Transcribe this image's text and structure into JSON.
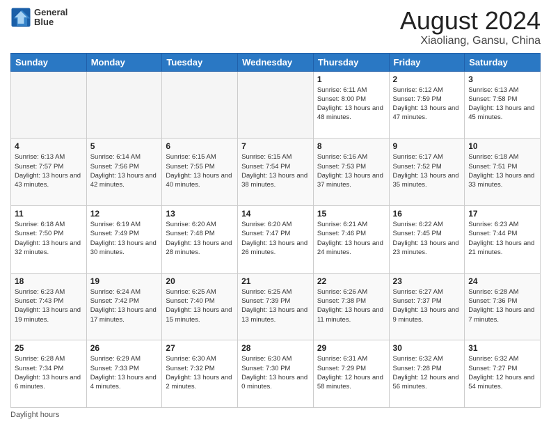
{
  "header": {
    "logo_line1": "General",
    "logo_line2": "Blue",
    "title": "August 2024",
    "subtitle": "Xiaoliang, Gansu, China"
  },
  "footer": {
    "label": "Daylight hours"
  },
  "days_of_week": [
    "Sunday",
    "Monday",
    "Tuesday",
    "Wednesday",
    "Thursday",
    "Friday",
    "Saturday"
  ],
  "weeks": [
    [
      {
        "day": "",
        "info": ""
      },
      {
        "day": "",
        "info": ""
      },
      {
        "day": "",
        "info": ""
      },
      {
        "day": "",
        "info": ""
      },
      {
        "day": "1",
        "info": "Sunrise: 6:11 AM\nSunset: 8:00 PM\nDaylight: 13 hours and 48 minutes."
      },
      {
        "day": "2",
        "info": "Sunrise: 6:12 AM\nSunset: 7:59 PM\nDaylight: 13 hours and 47 minutes."
      },
      {
        "day": "3",
        "info": "Sunrise: 6:13 AM\nSunset: 7:58 PM\nDaylight: 13 hours and 45 minutes."
      }
    ],
    [
      {
        "day": "4",
        "info": "Sunrise: 6:13 AM\nSunset: 7:57 PM\nDaylight: 13 hours and 43 minutes."
      },
      {
        "day": "5",
        "info": "Sunrise: 6:14 AM\nSunset: 7:56 PM\nDaylight: 13 hours and 42 minutes."
      },
      {
        "day": "6",
        "info": "Sunrise: 6:15 AM\nSunset: 7:55 PM\nDaylight: 13 hours and 40 minutes."
      },
      {
        "day": "7",
        "info": "Sunrise: 6:15 AM\nSunset: 7:54 PM\nDaylight: 13 hours and 38 minutes."
      },
      {
        "day": "8",
        "info": "Sunrise: 6:16 AM\nSunset: 7:53 PM\nDaylight: 13 hours and 37 minutes."
      },
      {
        "day": "9",
        "info": "Sunrise: 6:17 AM\nSunset: 7:52 PM\nDaylight: 13 hours and 35 minutes."
      },
      {
        "day": "10",
        "info": "Sunrise: 6:18 AM\nSunset: 7:51 PM\nDaylight: 13 hours and 33 minutes."
      }
    ],
    [
      {
        "day": "11",
        "info": "Sunrise: 6:18 AM\nSunset: 7:50 PM\nDaylight: 13 hours and 32 minutes."
      },
      {
        "day": "12",
        "info": "Sunrise: 6:19 AM\nSunset: 7:49 PM\nDaylight: 13 hours and 30 minutes."
      },
      {
        "day": "13",
        "info": "Sunrise: 6:20 AM\nSunset: 7:48 PM\nDaylight: 13 hours and 28 minutes."
      },
      {
        "day": "14",
        "info": "Sunrise: 6:20 AM\nSunset: 7:47 PM\nDaylight: 13 hours and 26 minutes."
      },
      {
        "day": "15",
        "info": "Sunrise: 6:21 AM\nSunset: 7:46 PM\nDaylight: 13 hours and 24 minutes."
      },
      {
        "day": "16",
        "info": "Sunrise: 6:22 AM\nSunset: 7:45 PM\nDaylight: 13 hours and 23 minutes."
      },
      {
        "day": "17",
        "info": "Sunrise: 6:23 AM\nSunset: 7:44 PM\nDaylight: 13 hours and 21 minutes."
      }
    ],
    [
      {
        "day": "18",
        "info": "Sunrise: 6:23 AM\nSunset: 7:43 PM\nDaylight: 13 hours and 19 minutes."
      },
      {
        "day": "19",
        "info": "Sunrise: 6:24 AM\nSunset: 7:42 PM\nDaylight: 13 hours and 17 minutes."
      },
      {
        "day": "20",
        "info": "Sunrise: 6:25 AM\nSunset: 7:40 PM\nDaylight: 13 hours and 15 minutes."
      },
      {
        "day": "21",
        "info": "Sunrise: 6:25 AM\nSunset: 7:39 PM\nDaylight: 13 hours and 13 minutes."
      },
      {
        "day": "22",
        "info": "Sunrise: 6:26 AM\nSunset: 7:38 PM\nDaylight: 13 hours and 11 minutes."
      },
      {
        "day": "23",
        "info": "Sunrise: 6:27 AM\nSunset: 7:37 PM\nDaylight: 13 hours and 9 minutes."
      },
      {
        "day": "24",
        "info": "Sunrise: 6:28 AM\nSunset: 7:36 PM\nDaylight: 13 hours and 7 minutes."
      }
    ],
    [
      {
        "day": "25",
        "info": "Sunrise: 6:28 AM\nSunset: 7:34 PM\nDaylight: 13 hours and 6 minutes."
      },
      {
        "day": "26",
        "info": "Sunrise: 6:29 AM\nSunset: 7:33 PM\nDaylight: 13 hours and 4 minutes."
      },
      {
        "day": "27",
        "info": "Sunrise: 6:30 AM\nSunset: 7:32 PM\nDaylight: 13 hours and 2 minutes."
      },
      {
        "day": "28",
        "info": "Sunrise: 6:30 AM\nSunset: 7:30 PM\nDaylight: 13 hours and 0 minutes."
      },
      {
        "day": "29",
        "info": "Sunrise: 6:31 AM\nSunset: 7:29 PM\nDaylight: 12 hours and 58 minutes."
      },
      {
        "day": "30",
        "info": "Sunrise: 6:32 AM\nSunset: 7:28 PM\nDaylight: 12 hours and 56 minutes."
      },
      {
        "day": "31",
        "info": "Sunrise: 6:32 AM\nSunset: 7:27 PM\nDaylight: 12 hours and 54 minutes."
      }
    ]
  ]
}
